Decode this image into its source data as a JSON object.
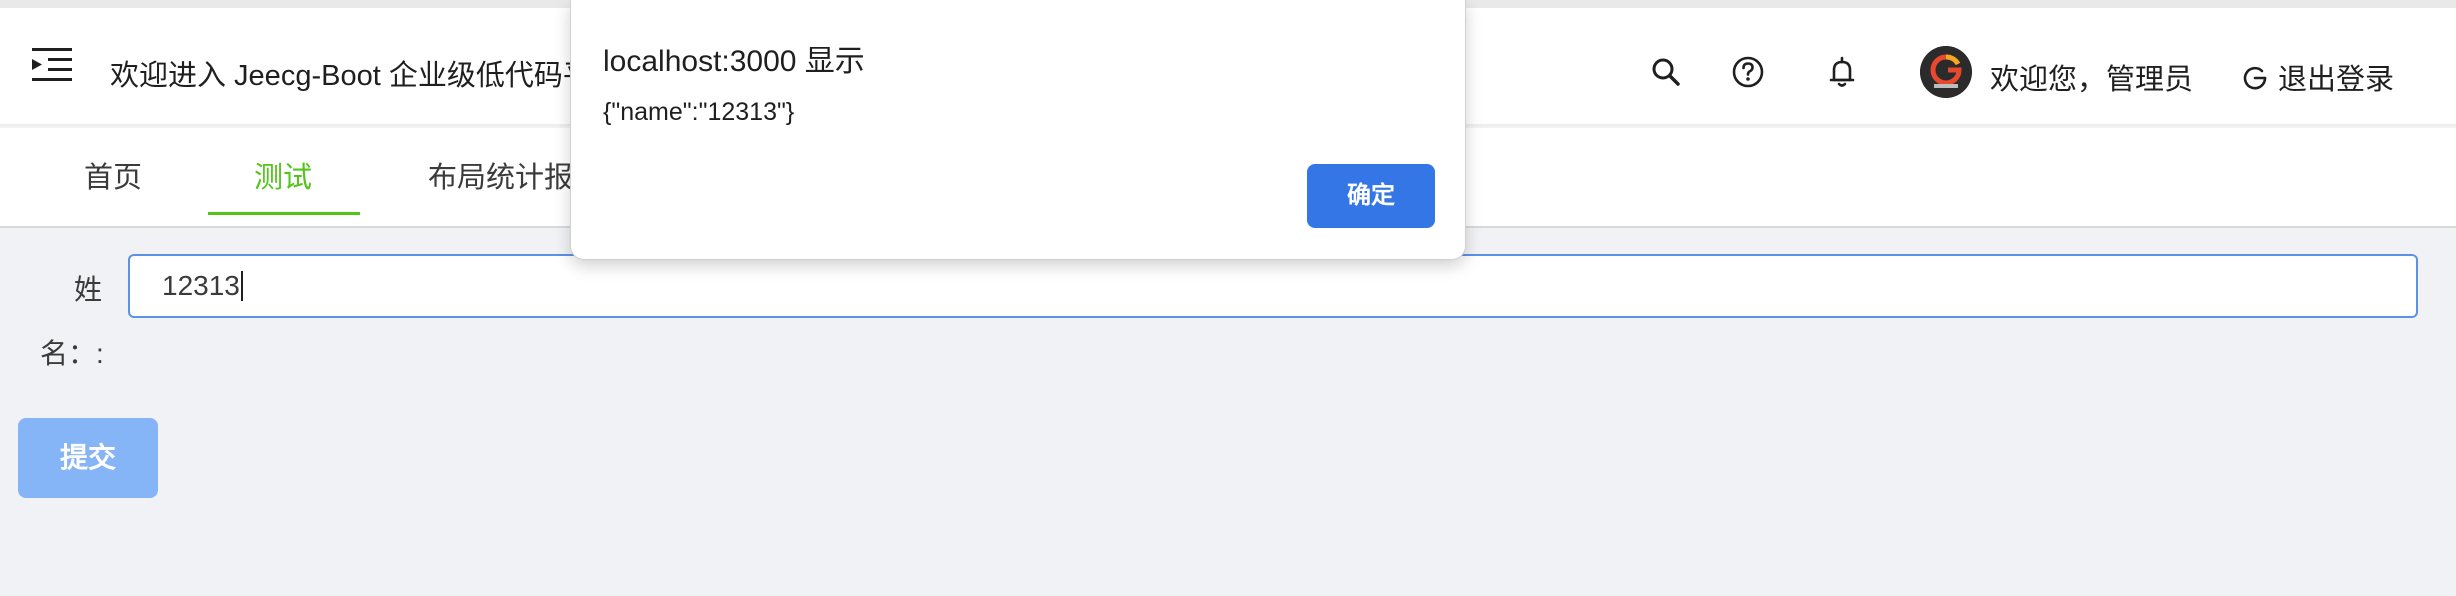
{
  "header": {
    "title": "欢迎进入 Jeecg-Boot 企业级低代码平台",
    "user_greeting": "欢迎您，管理员",
    "logout_label": "退出登录",
    "icons": [
      "menu-fold-icon",
      "search-icon",
      "question-circle-icon",
      "bell-icon",
      "logout-icon"
    ]
  },
  "tabs": [
    {
      "label": "首页",
      "active": false
    },
    {
      "label": "测试",
      "active": true
    },
    {
      "label": "布局统计报表",
      "active": false
    }
  ],
  "form": {
    "label_part1": "姓",
    "label_part2": "名：:",
    "name_value": "12313",
    "submit_label": "提交"
  },
  "dialog": {
    "title": "localhost:3000 显示",
    "message": "{\"name\":\"12313\"}",
    "ok_label": "确定"
  },
  "colors": {
    "active_tab": "#52c41a",
    "primary": "#3476e6",
    "submit_disabled": "#85b4f7",
    "input_focus_border": "#5a92e8"
  }
}
